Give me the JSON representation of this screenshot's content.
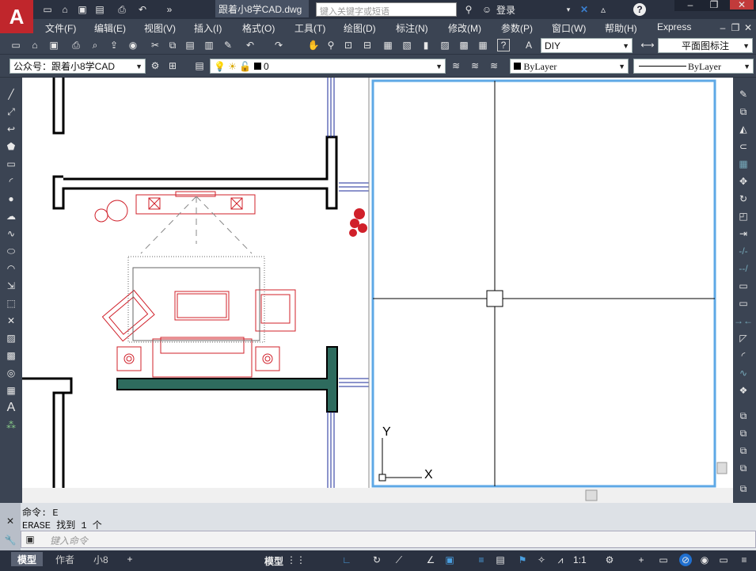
{
  "title_bar": {
    "file_name": "跟着小8学CAD.dwg",
    "search_placeholder": "键入关键字或短语",
    "login_label": "登录"
  },
  "menu": [
    "文件(F)",
    "编辑(E)",
    "视图(V)",
    "插入(I)",
    "格式(O)",
    "工具(T)",
    "绘图(D)",
    "标注(N)",
    "修改(M)",
    "参数(P)",
    "窗口(W)",
    "帮助(H)",
    "Express"
  ],
  "toolbar1": {
    "text_style": "DIY",
    "dim_style": "平面图标注"
  },
  "toolbar2": {
    "layer_filter": "公众号：跟着小8学CAD",
    "layer_current": "0",
    "color": "ByLayer",
    "linetype": "ByLayer"
  },
  "command_line": {
    "history": [
      "命令: E",
      "ERASE 找到 1 个"
    ],
    "placeholder": "键入命令"
  },
  "status_bar": {
    "tabs": [
      "模型",
      "作者",
      "小8"
    ],
    "model_label": "模型",
    "scale": "1:1"
  },
  "viewport": {
    "ucs_x": "X",
    "ucs_y": "Y"
  },
  "colors": {
    "accent_red": "#c0262c",
    "furniture_red": "#d0202a",
    "wall_fill": "#2e6b5e",
    "viewport_border": "#5ea8e6",
    "window_blue": "#1a2a9a"
  }
}
